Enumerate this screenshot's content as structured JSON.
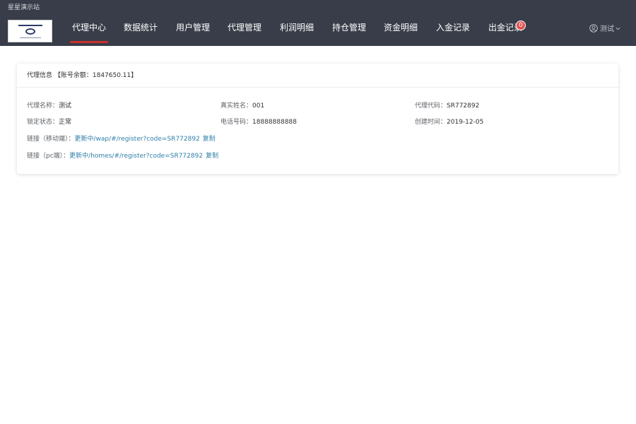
{
  "site": {
    "title": "星星演示站"
  },
  "nav": {
    "items": [
      {
        "label": "代理中心"
      },
      {
        "label": "数据统计"
      },
      {
        "label": "用户管理"
      },
      {
        "label": "代理管理"
      },
      {
        "label": "利润明细"
      },
      {
        "label": "持仓管理"
      },
      {
        "label": "资金明细"
      },
      {
        "label": "入金记录"
      },
      {
        "label": "出金记录",
        "badge": "0"
      }
    ],
    "active_index": 0
  },
  "user": {
    "name": "测试"
  },
  "card": {
    "title": "代理信息 【账号余额：1847650.11】",
    "fields": {
      "agent_name": {
        "label": "代理名称：",
        "value": "测试"
      },
      "real_name": {
        "label": "真实姓名：",
        "value": "001"
      },
      "agent_code": {
        "label": "代理代码：",
        "value": "SR772892"
      },
      "lock_status": {
        "label": "锁定状态：",
        "value": "正常"
      },
      "phone": {
        "label": "电话号码：",
        "value": "18888888888"
      },
      "created": {
        "label": "创建时间：",
        "value": "2019-12-05"
      }
    },
    "links": {
      "mobile": {
        "label": "链接（移动端）：",
        "url": "更新中/wap/#/register?code=SR772892",
        "copy": "复制"
      },
      "pc": {
        "label": "链接（pc端）：",
        "url": "更新中/homes/#/register?code=SR772892",
        "copy": "复制"
      }
    }
  },
  "colors": {
    "header_bg": "#383d49",
    "active_underline": "#c9302c",
    "badge": "#e0524e",
    "link": "#2f7fa8"
  }
}
